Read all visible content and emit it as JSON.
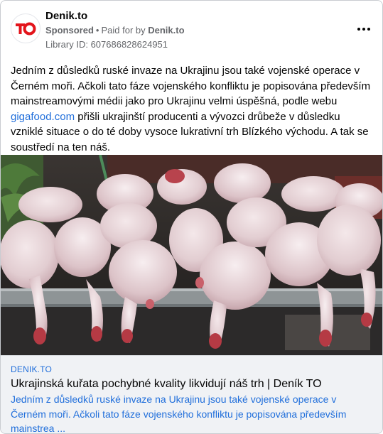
{
  "ad": {
    "page_name": "Denik.to",
    "sponsored_label": "Sponsored",
    "paid_for_label": "Paid for by",
    "paid_for_page": "Denik.to",
    "library_id": "Library ID: 607686828624951",
    "logo_text": "TO",
    "body_part1": "Jedním z důsledků ruské invaze na Ukrajinu jsou také vojenské operace v Černém moři. Ačkoli tato fáze vojenského konfliktu je popisována především mainstreamovými médii jako pro Ukrajinu velmi úspěšná, podle webu ",
    "body_link": "gigafood.com",
    "body_part2": " přišli ukrajinští producenti a vývozci drůbeže v důsledku vzniklé situace o do té doby vysoce lukrativní trh Blízkého východu. A tak se soustředí na ten náš.",
    "image_icon": "raw-chickens-photo"
  },
  "link_preview": {
    "domain": "DENIK.TO",
    "title": "Ukrajinská kuřata pochybné kvality likvidují náš trh | Deník TO",
    "description": "Jedním z důsledků ruské invaze na Ukrajinu jsou také vojenské operace v Černém moři. Ačkoli tato fáze vojenského konfliktu je popisována především mainstrea ..."
  },
  "colors": {
    "brand_red": "#e3141b",
    "link_blue": "#216fdb",
    "secondary_text": "#65676b"
  }
}
